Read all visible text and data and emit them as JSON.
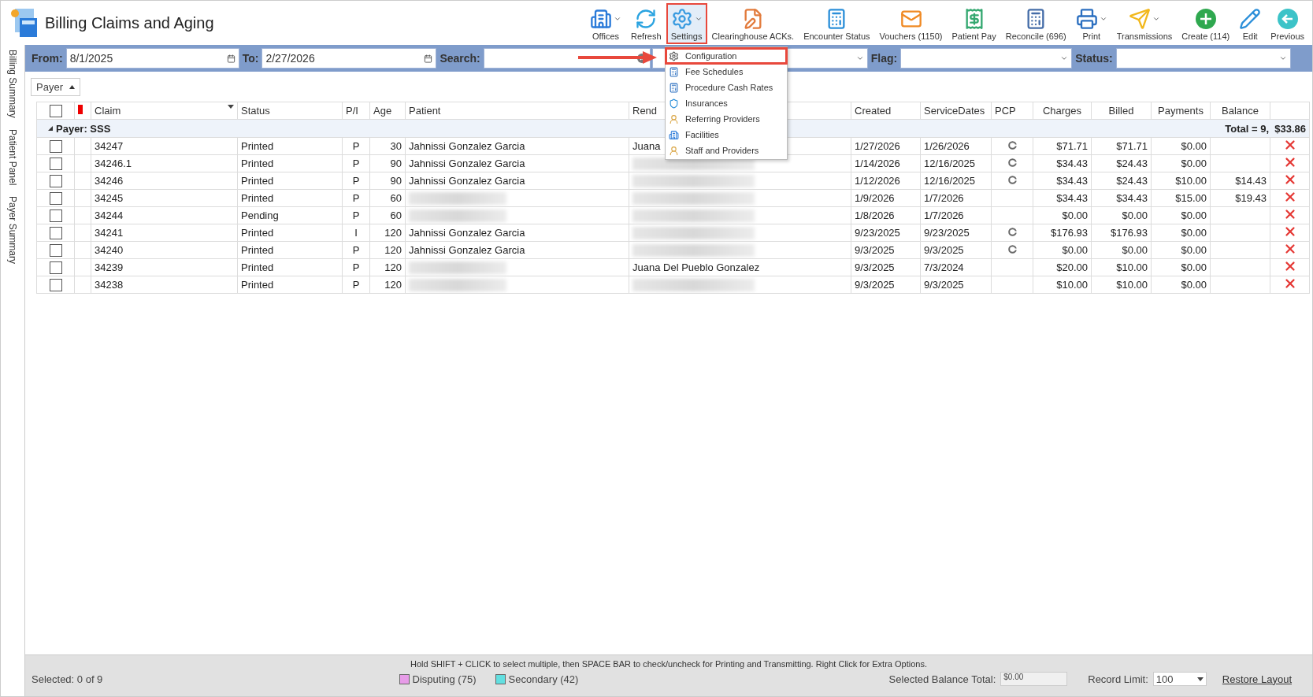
{
  "app": {
    "title": "Billing Claims and Aging"
  },
  "toolbar": [
    {
      "kind": "offices",
      "label": "Offices",
      "dropdown": true,
      "annotated": false
    },
    {
      "kind": "refresh",
      "label": "Refresh",
      "dropdown": false,
      "annotated": false
    },
    {
      "kind": "settings",
      "label": "Settings",
      "dropdown": true,
      "annotated": true
    },
    {
      "kind": "acks",
      "label": "Clearinghouse ACKs.",
      "dropdown": false,
      "annotated": false
    },
    {
      "kind": "encounter",
      "label": "Encounter Status",
      "dropdown": false,
      "annotated": false
    },
    {
      "kind": "vouchers",
      "label": "Vouchers (1150)",
      "dropdown": false,
      "annotated": false
    },
    {
      "kind": "patientpay",
      "label": "Patient Pay",
      "dropdown": false,
      "annotated": false
    },
    {
      "kind": "reconcile",
      "label": "Reconcile (696)",
      "dropdown": false,
      "annotated": false
    },
    {
      "kind": "print",
      "label": "Print",
      "dropdown": true,
      "annotated": false
    },
    {
      "kind": "send",
      "label": "Transmissions",
      "dropdown": true,
      "annotated": false
    },
    {
      "kind": "create",
      "label": "Create (114)",
      "dropdown": false,
      "annotated": false
    },
    {
      "kind": "edit",
      "label": "Edit",
      "dropdown": false,
      "annotated": false
    },
    {
      "kind": "previous",
      "label": "Previous",
      "dropdown": false,
      "annotated": false
    }
  ],
  "filters": {
    "from": {
      "label": "From:",
      "value": "8/1/2025"
    },
    "to": {
      "label": "To:",
      "value": "2/27/2026"
    },
    "search": {
      "label": "Search:"
    },
    "flag": {
      "label": "Flag:"
    },
    "status": {
      "label": "Status:"
    }
  },
  "side_tabs": [
    "Billing Summary",
    "Patient Panel",
    "Payer Summary"
  ],
  "group_chip": "Payer",
  "select_all": {
    "checked": false
  },
  "columns": [
    "Claim",
    "Status",
    "P/I",
    "Age",
    "Patient",
    "Rend",
    "Created",
    "ServiceDates",
    "PCP",
    "Charges",
    "Billed",
    "Payments",
    "Balance"
  ],
  "group": {
    "label": "Payer: SSS",
    "total": "Total = 9,  $33.86",
    "expanded": true
  },
  "rows": [
    {
      "checked": false,
      "claim": "34247",
      "status": "Printed",
      "pi": "P",
      "age": "30",
      "patient": "Jahnissi Gonzalez Garcia",
      "rendering": "Juana",
      "created": "1/27/2026",
      "service": "1/26/2026",
      "pcp": true,
      "charges": "$71.71",
      "billed": "$71.71",
      "payments": "$0.00"
    },
    {
      "checked": false,
      "claim": "34246.1",
      "status": "Printed",
      "pi": "P",
      "age": "90",
      "patient": "Jahnissi Gonzalez Garcia",
      "rendering_blurred": true,
      "created": "1/14/2026",
      "service": "12/16/2025",
      "pcp": true,
      "charges": "$34.43",
      "billed": "$24.43",
      "payments": "$0.00"
    },
    {
      "checked": false,
      "claim": "34246",
      "status": "Printed",
      "pi": "P",
      "age": "90",
      "patient": "Jahnissi Gonzalez Garcia",
      "rendering_blurred": true,
      "created": "1/12/2026",
      "service": "12/16/2025",
      "pcp": true,
      "charges": "$34.43",
      "billed": "$24.43",
      "payments": "$10.00",
      "balance": "$14.43"
    },
    {
      "checked": false,
      "claim": "34245",
      "status": "Printed",
      "pi": "P",
      "age": "60",
      "patient_blurred": true,
      "rendering_blurred": true,
      "created": "1/9/2026",
      "service": "1/7/2026",
      "pcp": false,
      "charges": "$34.43",
      "billed": "$34.43",
      "payments": "$15.00",
      "balance": "$19.43"
    },
    {
      "checked": false,
      "claim": "34244",
      "status": "Pending",
      "pi": "P",
      "age": "60",
      "patient_blurred": true,
      "rendering_blurred": true,
      "created": "1/8/2026",
      "service": "1/7/2026",
      "pcp": false,
      "charges": "$0.00",
      "billed": "$0.00",
      "payments": "$0.00"
    },
    {
      "checked": false,
      "claim": "34241",
      "status": "Printed",
      "pi": "I",
      "age": "120",
      "patient": "Jahnissi Gonzalez Garcia",
      "rendering_blurred": true,
      "created": "9/23/2025",
      "service": "9/23/2025",
      "pcp": true,
      "charges": "$176.93",
      "billed": "$176.93",
      "payments": "$0.00"
    },
    {
      "checked": false,
      "claim": "34240",
      "status": "Printed",
      "pi": "P",
      "age": "120",
      "patient": "Jahnissi Gonzalez Garcia",
      "rendering_blurred": true,
      "created": "9/3/2025",
      "service": "9/3/2025",
      "pcp": true,
      "charges": "$0.00",
      "billed": "$0.00",
      "payments": "$0.00"
    },
    {
      "checked": false,
      "claim": "34239",
      "status": "Printed",
      "pi": "P",
      "age": "120",
      "patient_blurred": true,
      "rendering": "Juana Del Pueblo Gonzalez",
      "created": "9/3/2025",
      "service": "7/3/2024",
      "pcp": false,
      "charges": "$20.00",
      "billed": "$10.00",
      "payments": "$0.00"
    },
    {
      "checked": false,
      "claim": "34238",
      "status": "Printed",
      "pi": "P",
      "age": "120",
      "patient_blurred": true,
      "rendering_blurred": true,
      "created": "9/3/2025",
      "service": "9/3/2025",
      "pcp": false,
      "charges": "$10.00",
      "billed": "$10.00",
      "payments": "$0.00"
    }
  ],
  "settings_menu": {
    "items": [
      {
        "kind": "gear",
        "label": "Configuration",
        "annotated": true
      },
      {
        "kind": "calc",
        "label": "Fee Schedules",
        "annotated": false
      },
      {
        "kind": "calc",
        "label": "Procedure Cash Rates",
        "annotated": false
      },
      {
        "kind": "shield",
        "label": "Insurances",
        "annotated": false
      },
      {
        "kind": "person",
        "label": "Referring Providers",
        "annotated": false
      },
      {
        "kind": "building",
        "label": "Facilities",
        "annotated": false
      },
      {
        "kind": "person",
        "label": "Staff and Providers",
        "annotated": false
      }
    ]
  },
  "footer": {
    "hint": "Hold SHIFT + CLICK to select multiple, then SPACE BAR to check/uncheck for Printing and Transmitting. Right Click for Extra Options.",
    "selected": "Selected: 0 of 9",
    "legend": [
      {
        "label": "Disputing (75)",
        "color": "#e79ce8"
      },
      {
        "label": "Secondary (42)",
        "color": "#62dfe0"
      }
    ],
    "balance_label": "Selected Balance Total:",
    "balance_value": "$0.00",
    "limit_label": "Record Limit:",
    "limit_value": "100",
    "restore": "Restore Layout"
  }
}
